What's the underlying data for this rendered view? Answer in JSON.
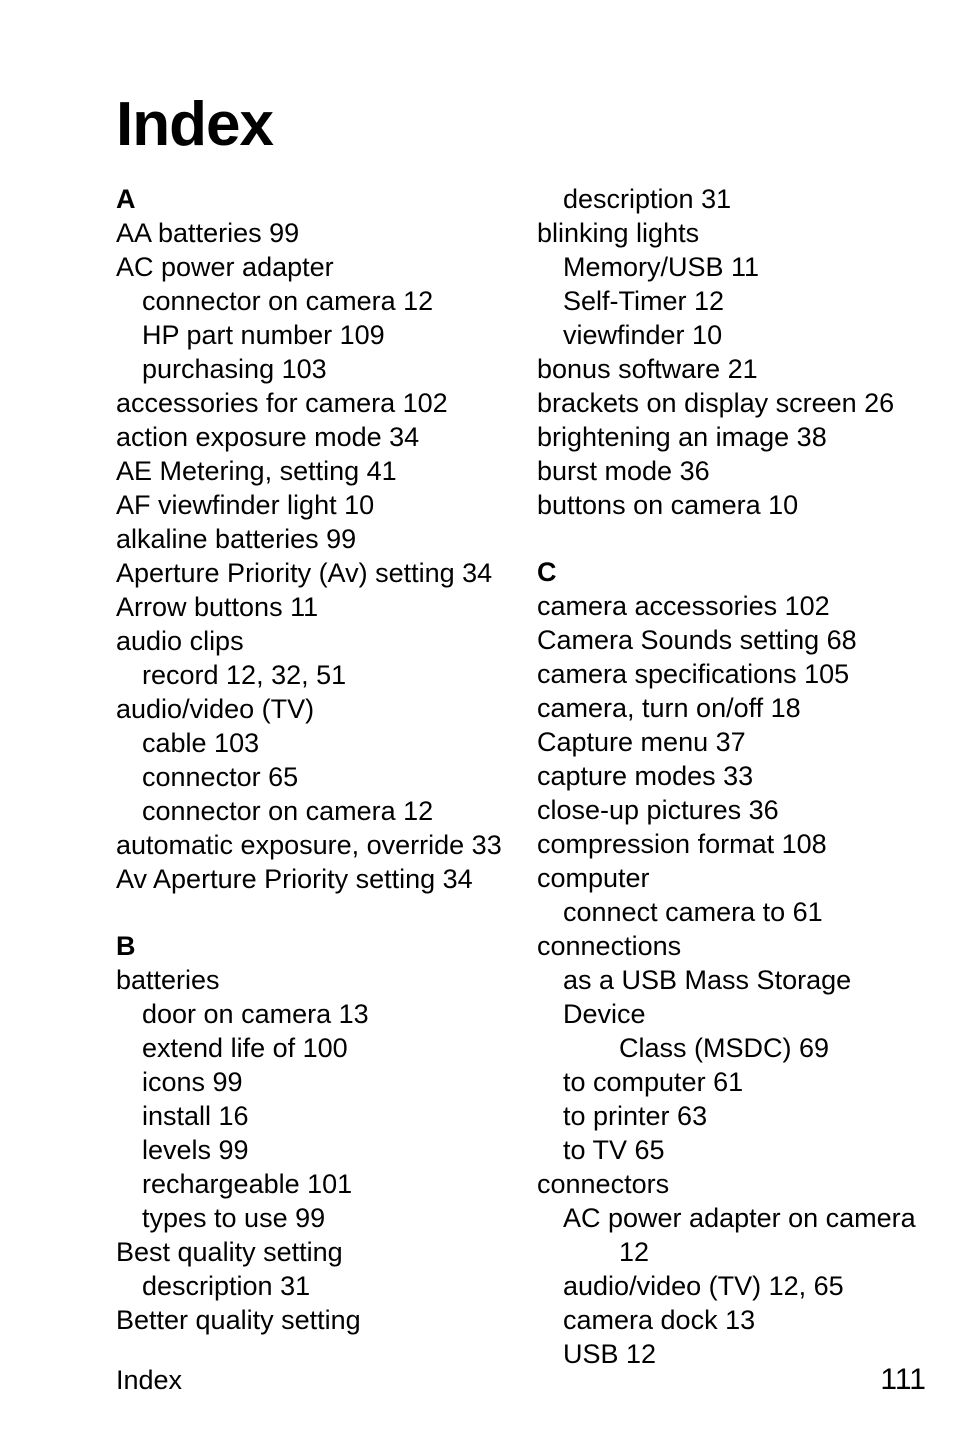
{
  "document": {
    "title": "Index",
    "page_number": "111",
    "footer_label": "Index"
  },
  "columns": [
    {
      "id": "left-column",
      "lines": [
        {
          "kind": "section",
          "level": 0,
          "spaced": false,
          "text": "A"
        },
        {
          "kind": "entry",
          "level": 0,
          "text": "AA batteries 99"
        },
        {
          "kind": "entry",
          "level": 0,
          "text": "AC power adapter"
        },
        {
          "kind": "entry",
          "level": 1,
          "text": "connector on camera 12"
        },
        {
          "kind": "entry",
          "level": 1,
          "text": "HP part number 109"
        },
        {
          "kind": "entry",
          "level": 1,
          "text": "purchasing 103"
        },
        {
          "kind": "entry",
          "level": 0,
          "text": "accessories for camera 102"
        },
        {
          "kind": "entry",
          "level": 0,
          "text": "action exposure mode 34"
        },
        {
          "kind": "entry",
          "level": 0,
          "text": "AE Metering, setting 41"
        },
        {
          "kind": "entry",
          "level": 0,
          "text": "AF viewfinder light 10"
        },
        {
          "kind": "entry",
          "level": 0,
          "text": "alkaline batteries 99"
        },
        {
          "kind": "entry",
          "level": 0,
          "text": "Aperture Priority (Av) setting 34"
        },
        {
          "kind": "entry",
          "level": 0,
          "text": "Arrow buttons 11"
        },
        {
          "kind": "entry",
          "level": 0,
          "text": "audio clips"
        },
        {
          "kind": "entry",
          "level": 1,
          "text": "record 12, 32, 51"
        },
        {
          "kind": "entry",
          "level": 0,
          "text": "audio/video (TV)"
        },
        {
          "kind": "entry",
          "level": 1,
          "text": "cable 103"
        },
        {
          "kind": "entry",
          "level": 1,
          "text": "connector 65"
        },
        {
          "kind": "entry",
          "level": 1,
          "text": "connector on camera 12"
        },
        {
          "kind": "entry",
          "level": 0,
          "text": "automatic exposure, override 33"
        },
        {
          "kind": "entry",
          "level": 0,
          "text": "Av Aperture Priority setting 34"
        },
        {
          "kind": "section",
          "level": 0,
          "spaced": true,
          "text": "B"
        },
        {
          "kind": "entry",
          "level": 0,
          "text": "batteries"
        },
        {
          "kind": "entry",
          "level": 1,
          "text": "door on camera 13"
        },
        {
          "kind": "entry",
          "level": 1,
          "text": "extend life of 100"
        },
        {
          "kind": "entry",
          "level": 1,
          "text": "icons 99"
        },
        {
          "kind": "entry",
          "level": 1,
          "text": "install 16"
        },
        {
          "kind": "entry",
          "level": 1,
          "text": "levels 99"
        },
        {
          "kind": "entry",
          "level": 1,
          "text": "rechargeable 101"
        },
        {
          "kind": "entry",
          "level": 1,
          "text": "types to use 99"
        },
        {
          "kind": "entry",
          "level": 0,
          "text": "Best quality setting"
        },
        {
          "kind": "entry",
          "level": 1,
          "text": "description 31"
        },
        {
          "kind": "entry",
          "level": 0,
          "text": "Better quality setting"
        }
      ]
    },
    {
      "id": "right-column",
      "lines": [
        {
          "kind": "entry",
          "level": 1,
          "text": "description 31"
        },
        {
          "kind": "entry",
          "level": 0,
          "text": "blinking lights"
        },
        {
          "kind": "entry",
          "level": 1,
          "text": "Memory/USB 11"
        },
        {
          "kind": "entry",
          "level": 1,
          "text": "Self-Timer 12"
        },
        {
          "kind": "entry",
          "level": 1,
          "text": "viewfinder 10"
        },
        {
          "kind": "entry",
          "level": 0,
          "text": "bonus software 21"
        },
        {
          "kind": "entry",
          "level": 0,
          "text": "brackets on display screen 26"
        },
        {
          "kind": "entry",
          "level": 0,
          "text": "brightening an image 38"
        },
        {
          "kind": "entry",
          "level": 0,
          "text": "burst mode 36"
        },
        {
          "kind": "entry",
          "level": 0,
          "text": "buttons on camera 10"
        },
        {
          "kind": "section",
          "level": 0,
          "spaced": true,
          "text": "C"
        },
        {
          "kind": "entry",
          "level": 0,
          "text": "camera accessories 102"
        },
        {
          "kind": "entry",
          "level": 0,
          "text": "Camera Sounds setting 68"
        },
        {
          "kind": "entry",
          "level": 0,
          "text": "camera specifications 105"
        },
        {
          "kind": "entry",
          "level": 0,
          "text": "camera, turn on/off 18"
        },
        {
          "kind": "entry",
          "level": 0,
          "text": "Capture menu 37"
        },
        {
          "kind": "entry",
          "level": 0,
          "text": "capture modes 33"
        },
        {
          "kind": "entry",
          "level": 0,
          "text": "close-up pictures 36"
        },
        {
          "kind": "entry",
          "level": 0,
          "text": "compression format 108"
        },
        {
          "kind": "entry",
          "level": 0,
          "text": "computer"
        },
        {
          "kind": "entry",
          "level": 1,
          "text": "connect camera to 61"
        },
        {
          "kind": "entry",
          "level": 0,
          "text": "connections"
        },
        {
          "kind": "entry",
          "level": 1,
          "text": "as a USB Mass Storage Device"
        },
        {
          "kind": "entry",
          "level": 2,
          "text": "Class (MSDC) 69"
        },
        {
          "kind": "entry",
          "level": 1,
          "text": "to computer 61"
        },
        {
          "kind": "entry",
          "level": 1,
          "text": "to printer 63"
        },
        {
          "kind": "entry",
          "level": 1,
          "text": "to TV 65"
        },
        {
          "kind": "entry",
          "level": 0,
          "text": "connectors"
        },
        {
          "kind": "entry",
          "level": 1,
          "text": "AC power adapter on camera"
        },
        {
          "kind": "entry",
          "level": 2,
          "text": "12"
        },
        {
          "kind": "entry",
          "level": 1,
          "text": "audio/video (TV) 12, 65"
        },
        {
          "kind": "entry",
          "level": 1,
          "text": "camera dock 13"
        },
        {
          "kind": "entry",
          "level": 1,
          "text": "USB 12"
        }
      ]
    }
  ]
}
